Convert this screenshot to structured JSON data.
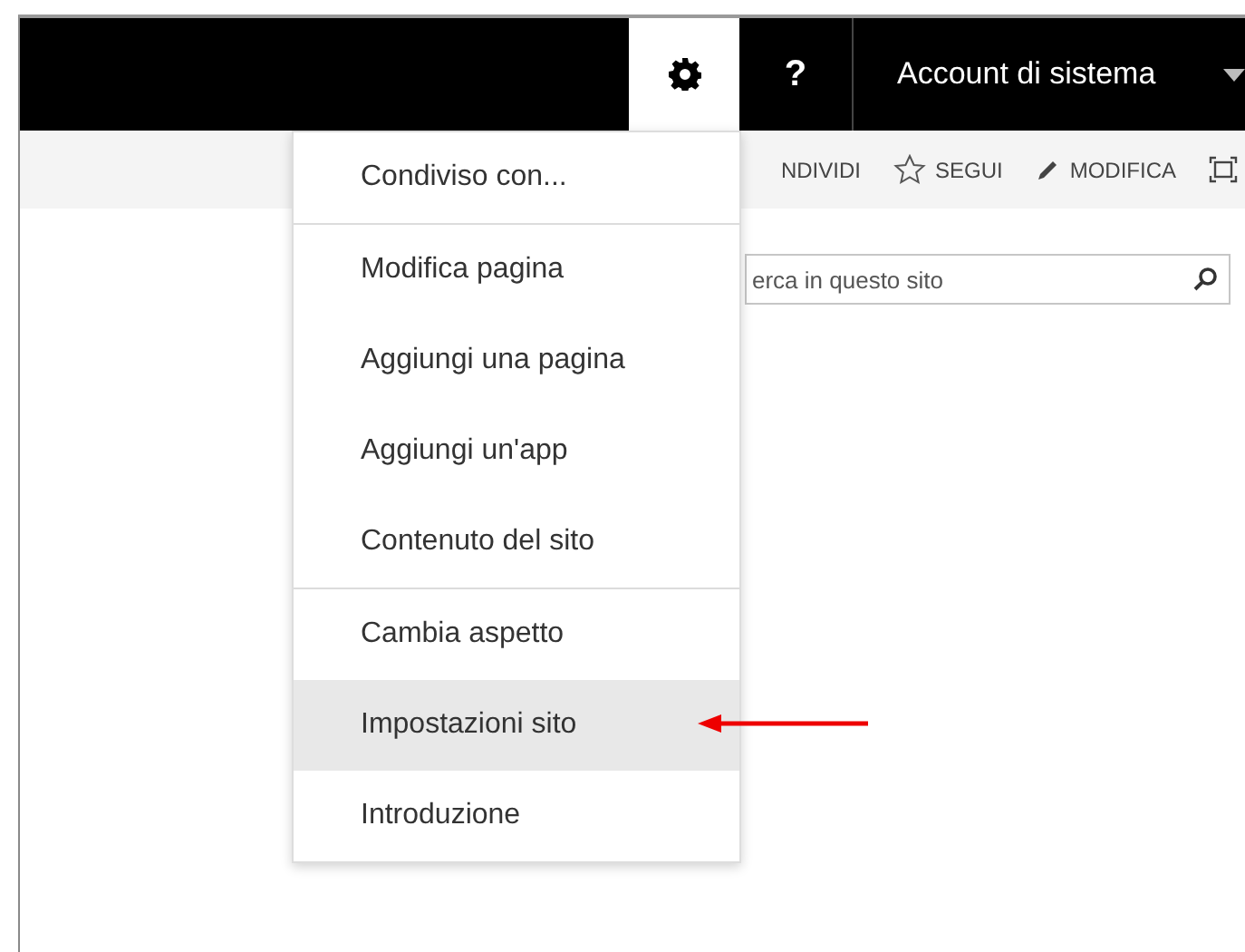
{
  "top_bar": {
    "settings_expanded": true,
    "help": "?",
    "account": "Account di sistema"
  },
  "ribbon": {
    "actions": [
      {
        "kind": "text",
        "label": "NDIVIDI"
      },
      {
        "kind": "star",
        "label": "SEGUI"
      },
      {
        "kind": "pencil",
        "label": "MODIFICA"
      },
      {
        "kind": "focus"
      }
    ]
  },
  "search": {
    "placeholder": "erca in questo sito"
  },
  "menu": {
    "groups": [
      [
        {
          "label": "Condiviso con...",
          "selected": false
        }
      ],
      [
        {
          "label": "Modifica pagina",
          "selected": false
        },
        {
          "label": "Aggiungi una pagina",
          "selected": false
        },
        {
          "label": "Aggiungi un'app",
          "selected": false
        },
        {
          "label": "Contenuto del sito",
          "selected": false
        }
      ],
      [
        {
          "label": "Cambia aspetto",
          "selected": false
        },
        {
          "label": "Impostazioni sito",
          "selected": true
        },
        {
          "label": "Introduzione",
          "selected": false
        }
      ]
    ]
  }
}
